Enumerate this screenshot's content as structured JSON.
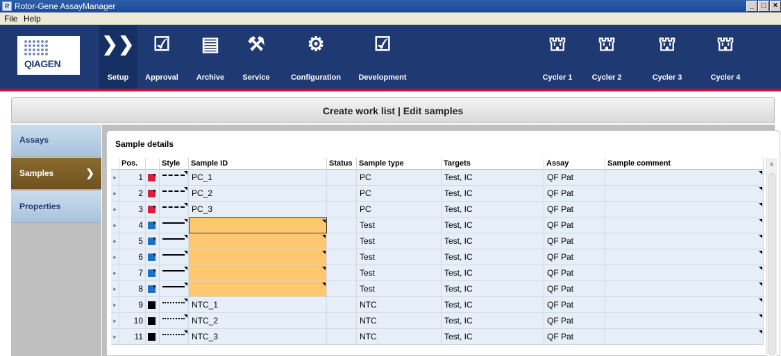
{
  "window": {
    "title": "Rotor-Gene AssayManager",
    "icon": "app-logo-icon"
  },
  "menu": {
    "items": [
      "File",
      "Help"
    ]
  },
  "logo": {
    "brand": "QIAGEN"
  },
  "toolbar": {
    "buttons": [
      {
        "label": "Setup",
        "icon": "setup-chevron-icon",
        "active": true
      },
      {
        "label": "Approval",
        "icon": "approval-check-icon",
        "active": false
      },
      {
        "label": "Archive",
        "icon": "archive-cabinet-icon",
        "active": false
      },
      {
        "label": "Service",
        "icon": "service-tools-icon",
        "active": false
      },
      {
        "label": "Configuration",
        "icon": "configuration-gears-icon",
        "active": false
      },
      {
        "label": "Development",
        "icon": "development-check-icon",
        "active": false
      },
      {
        "label": "Cycler 1",
        "icon": "cycler-icon",
        "active": false
      },
      {
        "label": "Cycler 2",
        "icon": "cycler-icon",
        "active": false
      },
      {
        "label": "Cycler 3",
        "icon": "cycler-icon",
        "active": false
      },
      {
        "label": "Cycler 4",
        "icon": "cycler-icon",
        "active": false
      }
    ]
  },
  "header": {
    "title": "Create work list | Edit samples"
  },
  "nav": {
    "items": [
      {
        "label": "Assays",
        "active": false
      },
      {
        "label": "Samples",
        "active": true
      },
      {
        "label": "Properties",
        "active": false
      }
    ]
  },
  "sample_details": {
    "title": "Sample details",
    "columns": [
      "Pos.",
      "",
      "Style",
      "Sample ID",
      "Status",
      "Sample type",
      "Targets",
      "Assay",
      "Sample comment"
    ],
    "rows": [
      {
        "pos": "1",
        "color": "#d81e3c",
        "style": "dashed",
        "sample_id": "PC_1",
        "status": "",
        "type": "PC",
        "targets": "Test, IC",
        "assay": "QF Pat",
        "comment": ""
      },
      {
        "pos": "2",
        "color": "#d81e3c",
        "style": "dashed",
        "sample_id": "PC_2",
        "status": "",
        "type": "PC",
        "targets": "Test, IC",
        "assay": "QF Pat",
        "comment": ""
      },
      {
        "pos": "3",
        "color": "#d81e3c",
        "style": "dashed",
        "sample_id": "PC_3",
        "status": "",
        "type": "PC",
        "targets": "Test, IC",
        "assay": "QF Pat",
        "comment": ""
      },
      {
        "pos": "4",
        "color": "#1f6fc2",
        "style": "solid",
        "sample_id": "",
        "status": "",
        "type": "Test",
        "targets": "Test, IC",
        "assay": "QF Pat",
        "comment": ""
      },
      {
        "pos": "5",
        "color": "#1f6fc2",
        "style": "solid",
        "sample_id": "",
        "status": "",
        "type": "Test",
        "targets": "Test, IC",
        "assay": "QF Pat",
        "comment": ""
      },
      {
        "pos": "6",
        "color": "#1f6fc2",
        "style": "solid",
        "sample_id": "",
        "status": "",
        "type": "Test",
        "targets": "Test, IC",
        "assay": "QF Pat",
        "comment": ""
      },
      {
        "pos": "7",
        "color": "#1f6fc2",
        "style": "solid",
        "sample_id": "",
        "status": "",
        "type": "Test",
        "targets": "Test, IC",
        "assay": "QF Pat",
        "comment": ""
      },
      {
        "pos": "8",
        "color": "#1f6fc2",
        "style": "solid",
        "sample_id": "",
        "status": "",
        "type": "Test",
        "targets": "Test, IC",
        "assay": "QF Pat",
        "comment": ""
      },
      {
        "pos": "9",
        "color": "#000000",
        "style": "dotted",
        "sample_id": "NTC_1",
        "status": "",
        "type": "NTC",
        "targets": "Test, IC",
        "assay": "QF Pat",
        "comment": ""
      },
      {
        "pos": "10",
        "color": "#000000",
        "style": "dotted",
        "sample_id": "NTC_2",
        "status": "",
        "type": "NTC",
        "targets": "Test, IC",
        "assay": "QF Pat",
        "comment": ""
      },
      {
        "pos": "11",
        "color": "#000000",
        "style": "dotted",
        "sample_id": "NTC_3",
        "status": "",
        "type": "NTC",
        "targets": "Test, IC",
        "assay": "QF Pat",
        "comment": ""
      }
    ]
  },
  "colors": {
    "toolbar_bg": "#1f3a73",
    "accent_red": "#c8103a",
    "editable_cell": "#ffc86e",
    "row_bg": "#e6eef8"
  }
}
